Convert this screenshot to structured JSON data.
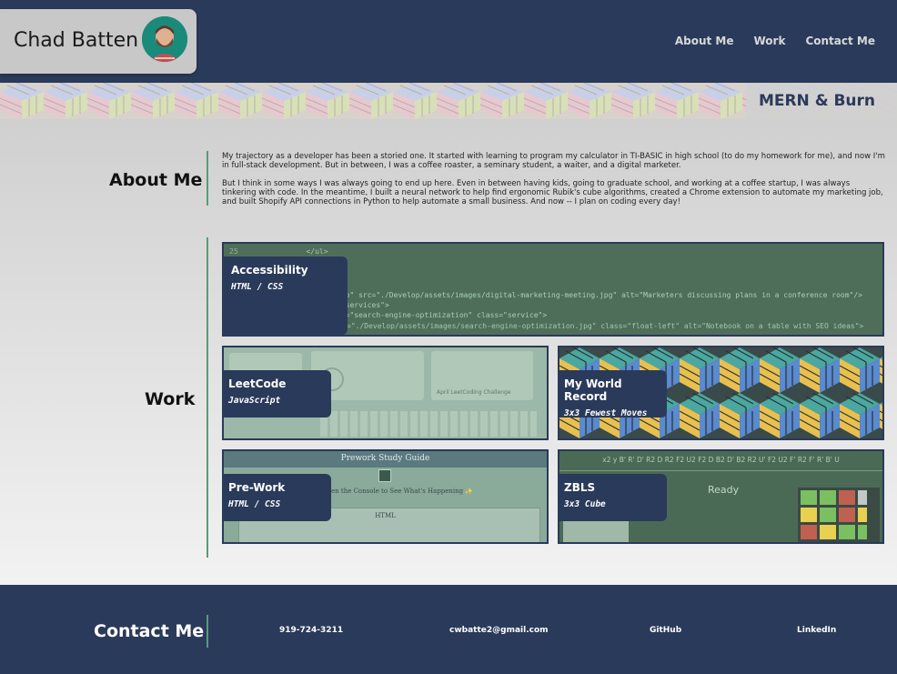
{
  "header": {
    "name": "Chad Batten",
    "nav": [
      "About Me",
      "Work",
      "Contact Me"
    ]
  },
  "banner": {
    "title": "MERN & Burn"
  },
  "about": {
    "heading": "About Me",
    "paragraphs": [
      "My trajectory as a developer has been a storied one. It started with learning to program my calculator in TI-BASIC in high school (to do my homework for me), and now I'm in full-stack development. But in between, I was a coffee roaster, a seminary student, a waiter, and a digital marketer.",
      "But I think in some ways I was always going to end up here. Even in between having kids, going to graduate school, and working at a coffee startup, I was always tinkering with code. In the meantime, I built a neural network to help find ergonomic Rubik's cube algorithms, created a Chrome extension to automate my marketing job, and built Shopify API connections in Python to help automate a small business. And now -- I plan on coding every day!"
    ]
  },
  "work": {
    "heading": "Work",
    "projects": [
      {
        "title": "Accessibility",
        "sub": "HTML / CSS"
      },
      {
        "title": "LeetCode",
        "sub": "JavaScript"
      },
      {
        "title": "My World Record",
        "sub": "3x3 Fewest Moves"
      },
      {
        "title": "Pre-Work",
        "sub": "HTML / CSS"
      },
      {
        "title": "ZBLS",
        "sub": "3x3 Cube"
      }
    ],
    "thumbs": {
      "code_lines": [
        {
          "num": "25",
          "text": "</ul>"
        },
        {
          "num": "32",
          "text": "<img src=\"./Develop/assets/images/search-engine-optimization.jpg\" class=\"float-left\" alt=\"Notebook on a table with SEO ideas\">"
        }
      ],
      "code_mid": [
        "ero\" src=\"./Develop/assets/images/digital-marketing-meeting.jpg\" alt=\"Marketers discussing plans in a conference room\"/>",
        "=\"services\">",
        "id=\"search-engine-optimization\" class=\"service\">"
      ],
      "prework_title": "Prework Study Guide",
      "prework_sub": "en the Console to See What's Happening ✨",
      "prework_section": "HTML",
      "zbls_scramble": "x2 y B' R' D' R2 D R2 F2 U2 F2 D B2 D' B2 R2 U' F2 U2 F' R2 F' R' B' U",
      "zbls_status": "Ready",
      "leetcode_challenge": "April LeetCoding Challenge"
    }
  },
  "contact": {
    "heading": "Contact Me",
    "links": [
      "919-724-3211",
      "cwbatte2@gmail.com",
      "GitHub",
      "LinkedIn"
    ]
  },
  "colors": {
    "navy": "#2a3a5a",
    "green": "#5a9a7a"
  }
}
